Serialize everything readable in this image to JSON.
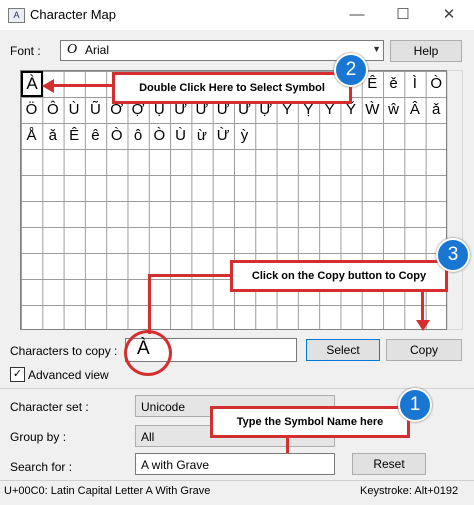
{
  "window": {
    "title": "Character Map",
    "icon": "character-map-icon",
    "minimize": "—",
    "maximize": "☐",
    "close": "✕"
  },
  "font": {
    "label": "Font :",
    "icon_glyph": "O",
    "value": "Arial"
  },
  "help_button": "Help",
  "grid": {
    "selected_char": "À",
    "rows": [
      [
        "À",
        "",
        "",
        "",
        "",
        "",
        "",
        "",
        "",
        "",
        "",
        "",
        "",
        "",
        "",
        "",
        "Ê",
        "ě",
        "Ì",
        "Ò"
      ],
      [
        "Ö",
        "Ô",
        "Ù",
        "Ũ",
        "Ớ",
        "Ợ",
        "Ụ",
        "Ư",
        "Ừ",
        "Ử",
        "Ữ",
        "Ự",
        "Ỳ",
        "Ỵ",
        "Ỷ",
        "Ỹ",
        "Ẁ",
        "ŵ",
        "Â",
        "ǎ"
      ],
      [
        "Å",
        "ǎ",
        "Ê",
        "ê",
        "Ò",
        "ô",
        "Ò",
        "Ù",
        "ừ",
        "Ừ",
        "ỳ",
        "",
        "",
        "",
        "",
        "",
        "",
        "",
        "",
        ""
      ]
    ]
  },
  "callouts": {
    "c1": {
      "number": "1",
      "text": "Type the Symbol Name here"
    },
    "c2": {
      "number": "2",
      "text": "Double Click Here to Select Symbol"
    },
    "c3": {
      "number": "3",
      "text": "Click on the Copy button to Copy"
    }
  },
  "copy_area": {
    "label": "Characters to copy :",
    "value": "À",
    "select_button": "Select",
    "copy_button": "Copy"
  },
  "advanced": {
    "label": "Advanced view",
    "checked": true,
    "check_glyph": "✓"
  },
  "character_set": {
    "label": "Character set :",
    "value": "Unicode"
  },
  "group_by": {
    "label": "Group by :",
    "value": "All"
  },
  "search": {
    "label": "Search for :",
    "value": "A with Grave",
    "reset_button": "Reset"
  },
  "status": {
    "left": "U+00C0: Latin Capital Letter A With Grave",
    "right": "Keystroke: Alt+0192"
  }
}
